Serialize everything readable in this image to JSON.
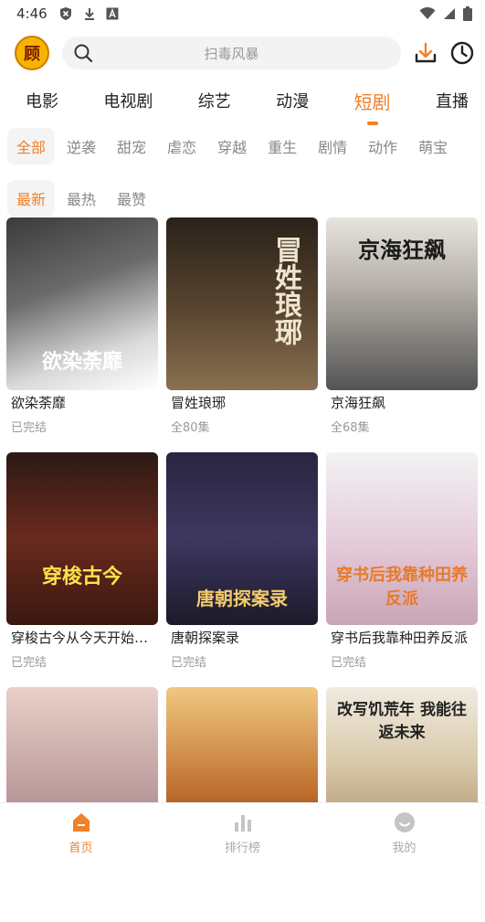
{
  "status": {
    "time": "4:46"
  },
  "header": {
    "logo_text": "顾",
    "search_placeholder": "扫毒风暴"
  },
  "category_tabs": [
    "电影",
    "电视剧",
    "综艺",
    "动漫",
    "短剧",
    "直播"
  ],
  "active_category": "短剧",
  "genres": [
    "全部",
    "逆袭",
    "甜宠",
    "虐恋",
    "穿越",
    "重生",
    "剧情",
    "动作",
    "萌宝"
  ],
  "active_genre": "全部",
  "sorts": [
    "最新",
    "最热",
    "最赞"
  ],
  "active_sort": "最新",
  "cards": [
    {
      "title": "欲染荼靡",
      "sub": "已完结",
      "poster_text": "欲染荼靡"
    },
    {
      "title": "冒姓琅琊",
      "sub": "全80集",
      "poster_text": "冒姓琅琊"
    },
    {
      "title": "京海狂飙",
      "sub": "全68集",
      "poster_text": "京海狂飙"
    },
    {
      "title": "穿梭古今从今天开始黑化",
      "sub": "已完结",
      "poster_text": "穿梭古今"
    },
    {
      "title": "唐朝探案录",
      "sub": "已完结",
      "poster_text": "唐朝探案录"
    },
    {
      "title": "穿书后我靠种田养反派",
      "sub": "已完结",
      "poster_text": "穿书后我靠种田养反派"
    },
    {
      "title": "",
      "sub": "",
      "poster_text": ""
    },
    {
      "title": "",
      "sub": "",
      "poster_text": ""
    },
    {
      "title": "",
      "sub": "",
      "poster_text": "改写饥荒年 我能往返未来"
    }
  ],
  "bottom_nav": [
    {
      "label": "首页",
      "icon": "home-icon",
      "active": true
    },
    {
      "label": "排行榜",
      "icon": "ranking-icon",
      "active": false
    },
    {
      "label": "我的",
      "icon": "profile-icon",
      "active": false
    }
  ],
  "colors": {
    "accent": "#f0802a"
  }
}
